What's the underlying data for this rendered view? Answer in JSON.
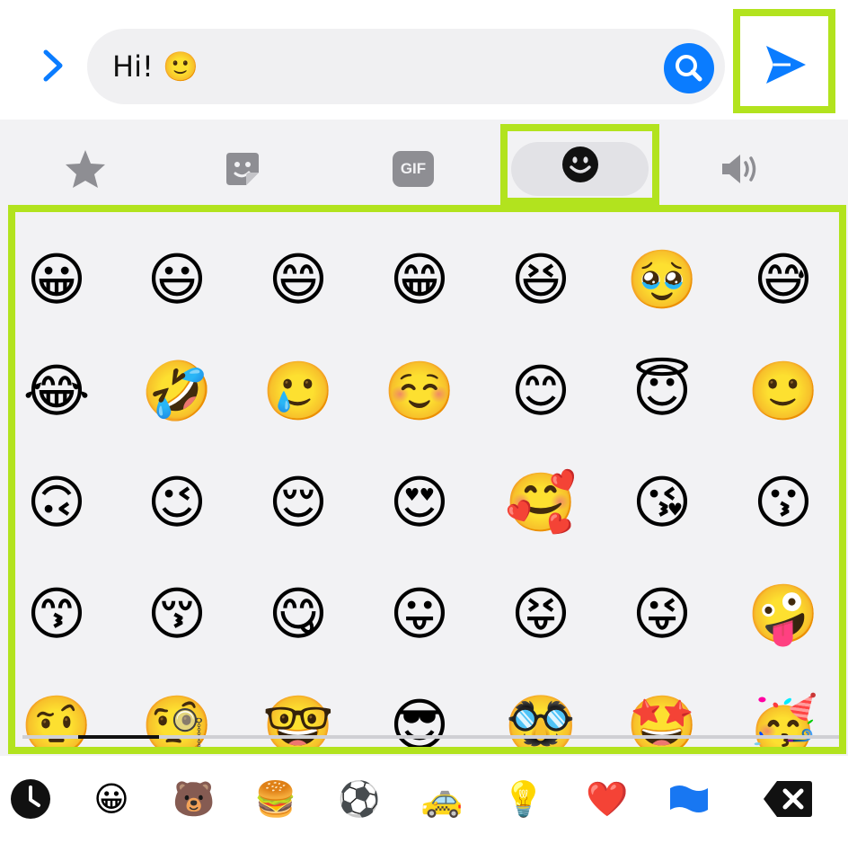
{
  "composer": {
    "text": "Hi! 🙂"
  },
  "colors": {
    "accent": "#0a7cff",
    "highlight": "#b2e31e",
    "tab_icon": "#8e8e93",
    "background": "#f2f2f4"
  },
  "tabs": [
    {
      "name": "favorites",
      "icon": "star-icon"
    },
    {
      "name": "stickers",
      "icon": "sticker-icon"
    },
    {
      "name": "gif",
      "icon": "gif-icon",
      "label": "GIF"
    },
    {
      "name": "emoji",
      "icon": "smiley-icon",
      "active": true
    },
    {
      "name": "sounds",
      "icon": "speaker-icon"
    }
  ],
  "emoji_rows": [
    [
      "😀",
      "😃",
      "😄",
      "😁",
      "😆",
      "🥹",
      "😅"
    ],
    [
      "😂",
      "🤣",
      "🥲",
      "☺️",
      "😊",
      "😇",
      "🙂"
    ],
    [
      "🙃",
      "😉",
      "😌",
      "😍",
      "🥰",
      "😘",
      "😗"
    ],
    [
      "😙",
      "😚",
      "😋",
      "😛",
      "😝",
      "😜",
      "🤪"
    ],
    [
      "🤨",
      "🧐",
      "🤓",
      "😎",
      "🥸",
      "🤩",
      "🥳"
    ]
  ],
  "categories": [
    {
      "name": "recent",
      "icon": "clock-icon"
    },
    {
      "name": "smileys",
      "glyph": "😀"
    },
    {
      "name": "animals",
      "glyph": "🐻"
    },
    {
      "name": "food",
      "glyph": "🍔"
    },
    {
      "name": "activity",
      "glyph": "⚽"
    },
    {
      "name": "travel",
      "glyph": "🚕"
    },
    {
      "name": "objects",
      "glyph": "💡"
    },
    {
      "name": "symbols",
      "glyph": "❤️"
    },
    {
      "name": "flags",
      "glyph": "🏳"
    },
    {
      "name": "delete",
      "icon": "backspace-icon"
    }
  ]
}
